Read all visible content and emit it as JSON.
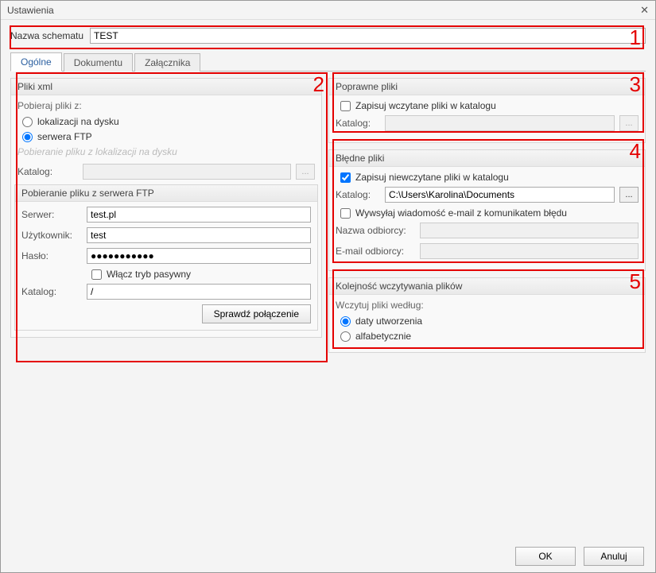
{
  "window": {
    "title": "Ustawienia",
    "close_glyph": "✕"
  },
  "schema": {
    "label": "Nazwa schematu",
    "value": "TEST"
  },
  "tabs": {
    "general": "Ogólne",
    "document": "Dokumentu",
    "attachment": "Załącznika"
  },
  "xml": {
    "title": "Pliki xml",
    "download_from": "Pobieraj pliki z:",
    "opt_disk": "lokalizacji na dysku",
    "opt_ftp": "serwera FTP",
    "disk_sub": "Pobieranie pliku z lokalizacji na dysku",
    "disk_katalog_label": "Katalog:",
    "disk_katalog_value": "",
    "ftp_sub": "Pobieranie pliku z serwera FTP",
    "server_label": "Serwer:",
    "server_value": "test.pl",
    "user_label": "Użytkownik:",
    "user_value": "test",
    "pass_label": "Hasło:",
    "pass_value": "●●●●●●●●●●●",
    "passive_label": "Włącz tryb pasywny",
    "ftp_katalog_label": "Katalog:",
    "ftp_katalog_value": "/",
    "check_button": "Sprawdź połączenie"
  },
  "correct": {
    "title": "Poprawne pliki",
    "save_label": "Zapisuj wczytane pliki w katalogu",
    "katalog_label": "Katalog:",
    "katalog_value": ""
  },
  "wrong": {
    "title": "Błędne pliki",
    "save_label": "Zapisuj niewczytane pliki w katalogu",
    "katalog_label": "Katalog:",
    "katalog_value": "C:\\Users\\Karolina\\Documents",
    "email_check": "Wywsyłaj wiadomość e-mail z komunikatem błędu",
    "recipient_name_label": "Nazwa odbiorcy:",
    "recipient_name_value": "",
    "recipient_email_label": "E-mail odbiorcy:",
    "recipient_email_value": ""
  },
  "order": {
    "title": "Kolejność wczytywania plików",
    "subtitle": "Wczytuj pliki według:",
    "opt_date": "daty utworzenia",
    "opt_alpha": "alfabetycznie"
  },
  "footer": {
    "ok": "OK",
    "cancel": "Anuluj"
  },
  "browse": {
    "dots": "..."
  },
  "annotations": {
    "n1": "1",
    "n2": "2",
    "n3": "3",
    "n4": "4",
    "n5": "5"
  }
}
